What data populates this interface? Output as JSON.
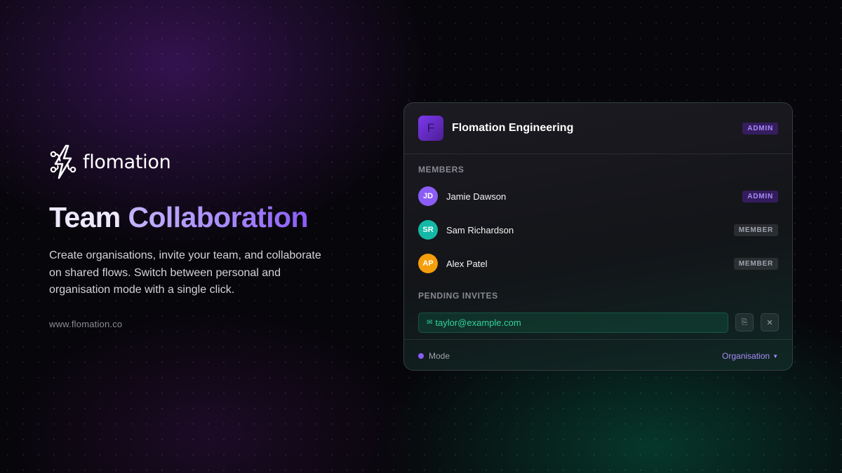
{
  "brand": {
    "name": "flomation",
    "logo_icon": "lightning-flow-icon"
  },
  "headline": {
    "word1": "Team",
    "word2": "Collaboration"
  },
  "description": "Create organisations, invite your team, and collaborate on shared flows. Switch between personal and organisation mode with a single click.",
  "website": "www.flomation.co",
  "card": {
    "org": {
      "initial": "F",
      "name": "Flomation Engineering",
      "role": "ADMIN"
    },
    "members_label": "MEMBERS",
    "members": [
      {
        "initials": "JD",
        "name": "Jamie Dawson",
        "role": "ADMIN",
        "color": "#8b5cf6"
      },
      {
        "initials": "SR",
        "name": "Sam Richardson",
        "role": "MEMBER",
        "color": "#14b8a6"
      },
      {
        "initials": "AP",
        "name": "Alex Patel",
        "role": "MEMBER",
        "color": "#f59e0b"
      }
    ],
    "pending_label": "PENDING INVITES",
    "invite": {
      "icon": "envelope-icon",
      "email": "taylor@example.com"
    },
    "invite_actions": {
      "copy_icon": "copy-icon",
      "remove_icon": "close-icon",
      "remove_glyph": "✕",
      "copy_glyph": "⎘"
    },
    "footer": {
      "mode_label": "Mode",
      "mode_value": "Organisation",
      "caret_icon": "chevron-down-icon"
    }
  },
  "colors": {
    "accent_purple": "#8b5cf6",
    "accent_green": "#34d399",
    "background": "#07060a"
  }
}
